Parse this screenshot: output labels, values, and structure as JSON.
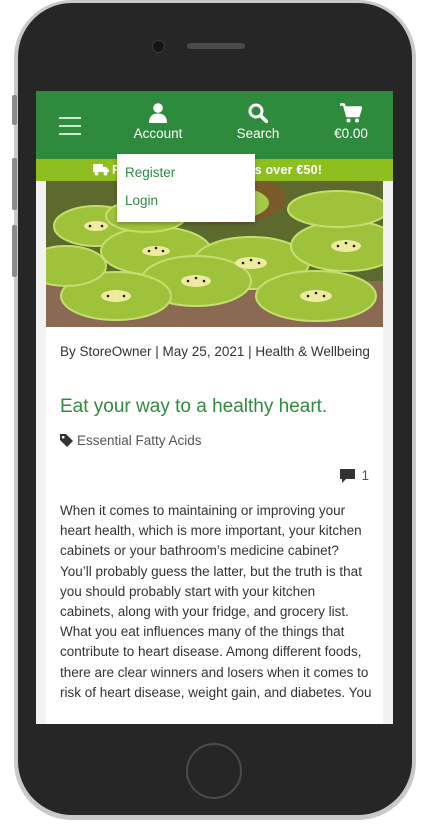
{
  "header": {
    "account_label": "Account",
    "search_label": "Search",
    "cart_total": "€0.00"
  },
  "banner": {
    "text": "FREE delivery on orders over €50!"
  },
  "account_menu": {
    "items": [
      "Register",
      "Login"
    ]
  },
  "post": {
    "meta": "By StoreOwner | May 25, 2021 | Health & Wellbeing",
    "title": "Eat your way to a healthy heart.",
    "tag": "Essential Fatty Acids",
    "comment_count": "1",
    "excerpt": "When it comes to maintaining or improving your heart health, which is more important, your kitchen cabinets or your bathroom’s medicine cabinet? You’ll probably guess the latter, but the truth is that you should probably start with your kitchen cabinets, along with your fridge, and grocery list. What you eat influences many of the things that contribute to heart disease. Among different foods, there are clear winners and losers when it comes to risk of heart disease, weight gain, and diabetes. You"
  },
  "colors": {
    "brand_green": "#2e8b3d",
    "banner_green": "#8fbf1f"
  },
  "icons": [
    "menu-icon",
    "user-icon",
    "search-icon",
    "cart-icon",
    "truck-icon",
    "tag-icon",
    "comment-icon"
  ]
}
